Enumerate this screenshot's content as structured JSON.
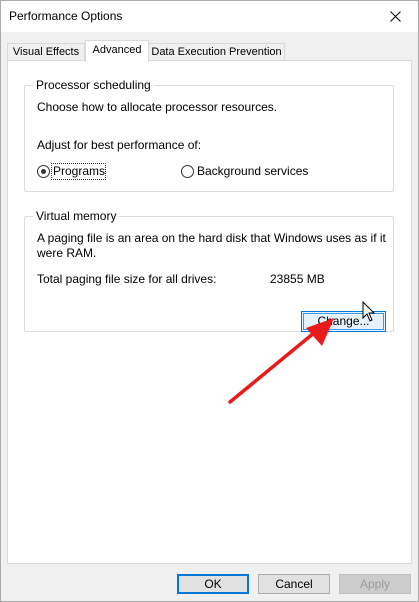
{
  "window": {
    "title": "Performance Options",
    "close_icon": "close-icon"
  },
  "tabs": [
    {
      "label": "Visual Effects",
      "active": false
    },
    {
      "label": "Advanced",
      "active": true
    },
    {
      "label": "Data Execution Prevention",
      "active": false
    }
  ],
  "processor": {
    "group_title": "Processor scheduling",
    "description": "Choose how to allocate processor resources.",
    "adjust_label": "Adjust for best performance of:",
    "options": [
      {
        "label": "Programs",
        "selected": true
      },
      {
        "label": "Background services",
        "selected": false
      }
    ]
  },
  "virtual_memory": {
    "group_title": "Virtual memory",
    "description_line1": "A paging file is an area on the hard disk that Windows uses as if it",
    "description_line2": "were RAM.",
    "total_label": "Total paging file size for all drives:",
    "total_value": "23855 MB",
    "change_button": "Change..."
  },
  "buttons": {
    "ok": "OK",
    "cancel": "Cancel",
    "apply": "Apply"
  },
  "colors": {
    "accent": "#0078d7",
    "annotation_arrow": "#e81a1a",
    "window_bg": "#f0f0f0"
  }
}
